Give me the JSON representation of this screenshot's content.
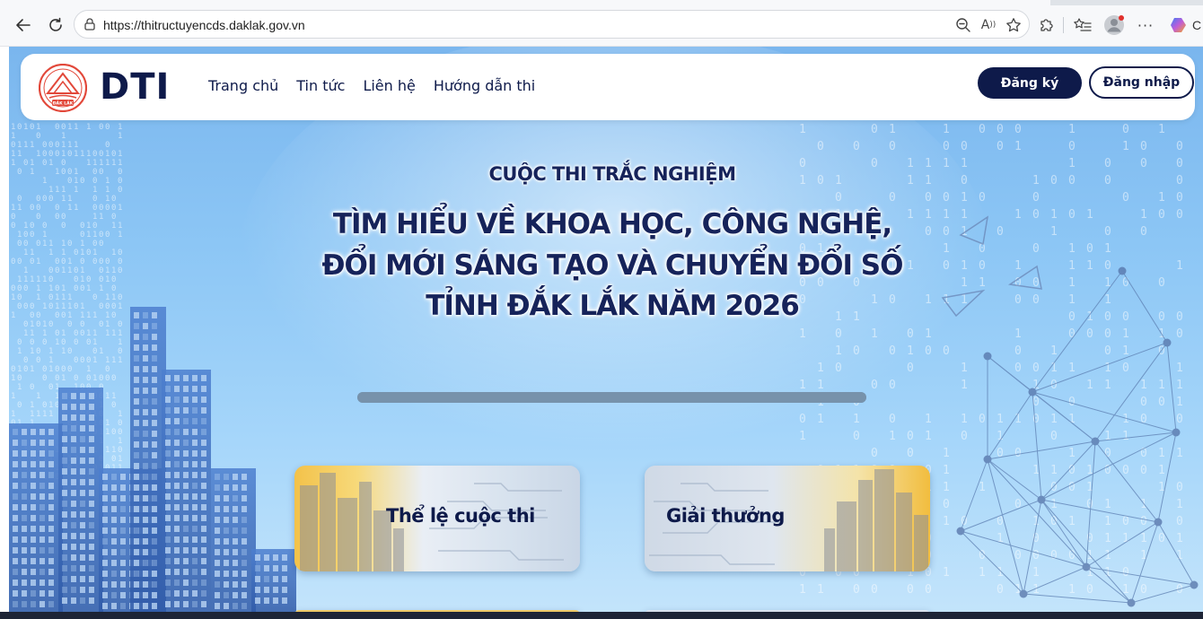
{
  "browser": {
    "url": "https://thitructuyencds.daklak.gov.vn",
    "copilot_label": "C"
  },
  "header": {
    "logo_text": "DTI",
    "seal_text": "ĐẮK LẮK",
    "nav": [
      "Trang chủ",
      "Tin tức",
      "Liên hệ",
      "Hướng dẫn thi"
    ],
    "register_label": "Đăng ký",
    "login_label": "Đăng nhập"
  },
  "hero": {
    "subtitle": "CUỘC THI TRẮC NGHIỆM",
    "title_lines": [
      "TÌM HIỂU VỀ KHOA HỌC, CÔNG NGHỆ,",
      "ĐỔI MỚI SÁNG TẠO VÀ CHUYỂN ĐỔI SỐ",
      "TỈNH ĐẮK LẮK NĂM 2026"
    ],
    "progress": 1.0
  },
  "cards": [
    {
      "label": "Thể lệ cuộc thi"
    },
    {
      "label": "Giải thưởng"
    }
  ],
  "colors": {
    "brand_navy": "#0e1a4a",
    "seal_red": "#e2483a",
    "sky_top": "#7ab6ee",
    "sky_bottom": "#c3e4fb"
  },
  "icons": {
    "back": "arrow-left-icon",
    "reload": "reload-icon",
    "lock": "lock-icon",
    "zoom": "zoom-out-icon",
    "read_aloud": "read-aloud-icon",
    "favorite": "star-icon",
    "extensions": "puzzle-icon",
    "favorites_bar": "favorites-icon",
    "profile": "avatar-icon",
    "more": "more-icon",
    "copilot": "copilot-icon"
  }
}
